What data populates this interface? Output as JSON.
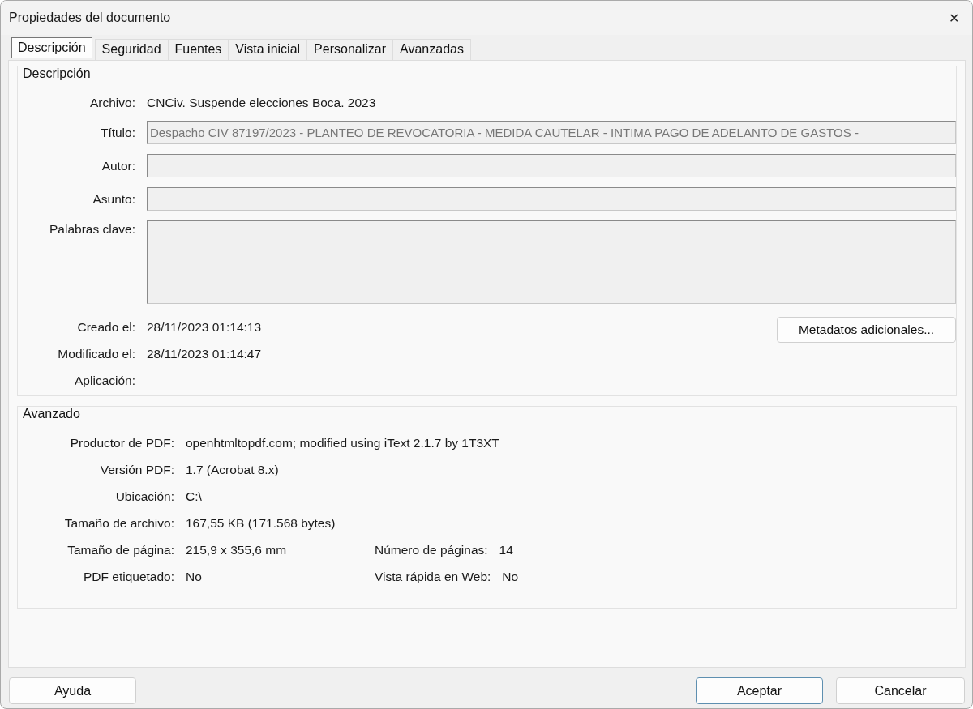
{
  "window": {
    "title": "Propiedades del documento",
    "close": "✕"
  },
  "tabs": [
    {
      "label": "Descripción",
      "selected": true
    },
    {
      "label": "Seguridad",
      "selected": false
    },
    {
      "label": "Fuentes",
      "selected": false
    },
    {
      "label": "Vista inicial",
      "selected": false
    },
    {
      "label": "Personalizar",
      "selected": false
    },
    {
      "label": "Avanzadas",
      "selected": false
    }
  ],
  "description": {
    "title": "Descripción",
    "file": {
      "label": "Archivo:",
      "value": "CNCiv. Suspende elecciones Boca. 2023"
    },
    "fields": [
      {
        "label": "Título:",
        "value": "Despacho CIV 87197/2023 - PLANTEO DE REVOCATORIA - MEDIDA CAUTELAR - INTIMA PAGO DE ADELANTO DE GASTOS -",
        "kind": "line"
      },
      {
        "label": "Autor:",
        "kind": "line"
      },
      {
        "label": "Asunto:",
        "kind": "line"
      },
      {
        "label": "Palabras clave:",
        "kind": "area"
      }
    ],
    "dates": [
      {
        "label": "Creado el:",
        "value": "28/11/2023 01:14:13"
      },
      {
        "label": "Modificado el:",
        "value": "28/11/2023 01:14:47"
      },
      {
        "label": "Aplicación:"
      }
    ],
    "metadata_button": "Metadatos adicionales..."
  },
  "advanced": {
    "title": "Avanzado",
    "rows": [
      {
        "items": [
          {
            "label": "Productor de PDF:",
            "value": "openhtmltopdf.com; modified using iText 2.1.7 by 1T3XT"
          }
        ]
      },
      {
        "items": [
          {
            "label": "Versión PDF:",
            "value": "1.7 (Acrobat 8.x)"
          }
        ]
      },
      {
        "items": [
          {
            "label": "Ubicación:",
            "value": "C:\\"
          }
        ]
      },
      {
        "items": [
          {
            "label": "Tamaño de archivo:",
            "value": "167,55 KB (171.568 bytes)"
          }
        ]
      },
      {
        "items": [
          {
            "label": "Tamaño de página:",
            "value": "215,9 x 355,6 mm"
          },
          {
            "label": "Número de páginas:",
            "value": "14"
          }
        ]
      },
      {
        "items": [
          {
            "label": "PDF etiquetado:",
            "value": "No"
          },
          {
            "label": "Vista rápida en Web:",
            "value": "No"
          }
        ]
      }
    ]
  },
  "buttons": {
    "help": "Ayuda",
    "ok": "Aceptar",
    "cancel": "Cancelar"
  }
}
